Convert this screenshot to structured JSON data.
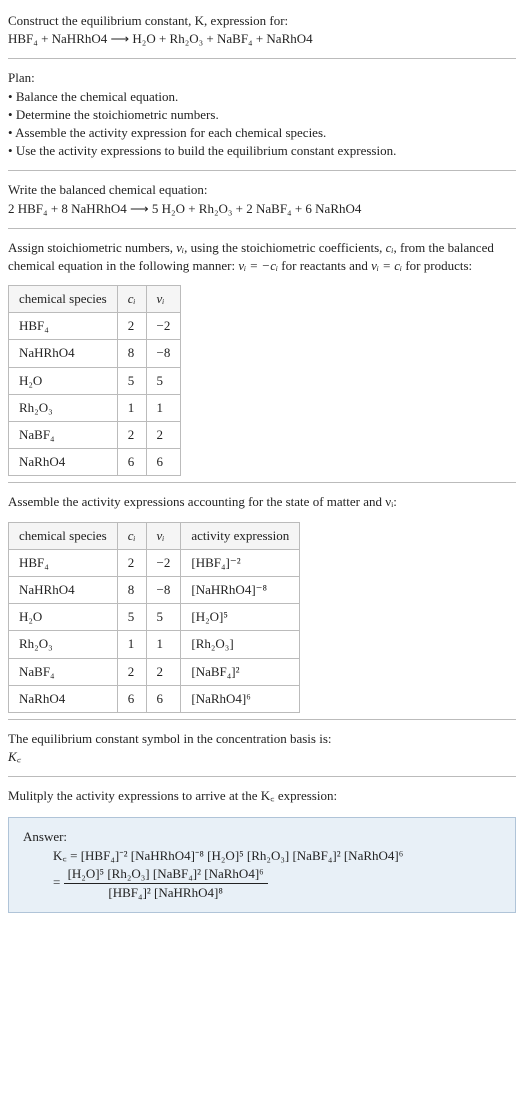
{
  "header": {
    "title_line": "Construct the equilibrium constant, K, expression for:",
    "equation": "HBF₄ + NaHRhO4 ⟶ H₂O + Rh₂O₃ + NaBF₄ + NaRhO4"
  },
  "plan": {
    "heading": "Plan:",
    "items": [
      "Balance the chemical equation.",
      "Determine the stoichiometric numbers.",
      "Assemble the activity expression for each chemical species.",
      "Use the activity expressions to build the equilibrium constant expression."
    ]
  },
  "balanced": {
    "heading": "Write the balanced chemical equation:",
    "equation": "2 HBF₄ + 8 NaHRhO4 ⟶ 5 H₂O + Rh₂O₃ + 2 NaBF₄ + 6 NaRhO4"
  },
  "assign": {
    "text_a": "Assign stoichiometric numbers, ",
    "nu": "νᵢ",
    "text_b": ", using the stoichiometric coefficients, ",
    "ci": "cᵢ",
    "text_c": ", from the balanced chemical equation in the following manner: ",
    "rel1": "νᵢ = −cᵢ",
    "text_d": " for reactants and ",
    "rel2": "νᵢ = cᵢ",
    "text_e": " for products:"
  },
  "table1": {
    "headers": [
      "chemical species",
      "cᵢ",
      "νᵢ"
    ],
    "rows": [
      [
        "HBF₄",
        "2",
        "−2"
      ],
      [
        "NaHRhO4",
        "8",
        "−8"
      ],
      [
        "H₂O",
        "5",
        "5"
      ],
      [
        "Rh₂O₃",
        "1",
        "1"
      ],
      [
        "NaBF₄",
        "2",
        "2"
      ],
      [
        "NaRhO4",
        "6",
        "6"
      ]
    ]
  },
  "assemble": {
    "text": "Assemble the activity expressions accounting for the state of matter and νᵢ:"
  },
  "table2": {
    "headers": [
      "chemical species",
      "cᵢ",
      "νᵢ",
      "activity expression"
    ],
    "rows": [
      {
        "sp": "HBF₄",
        "c": "2",
        "nu": "−2",
        "expr": "[HBF₄]⁻²"
      },
      {
        "sp": "NaHRhO4",
        "c": "8",
        "nu": "−8",
        "expr": "[NaHRhO4]⁻⁸"
      },
      {
        "sp": "H₂O",
        "c": "5",
        "nu": "5",
        "expr": "[H₂O]⁵"
      },
      {
        "sp": "Rh₂O₃",
        "c": "1",
        "nu": "1",
        "expr": "[Rh₂O₃]"
      },
      {
        "sp": "NaBF₄",
        "c": "2",
        "nu": "2",
        "expr": "[NaBF₄]²"
      },
      {
        "sp": "NaRhO4",
        "c": "6",
        "nu": "6",
        "expr": "[NaRhO4]⁶"
      }
    ]
  },
  "symbol": {
    "line1": "The equilibrium constant symbol in the concentration basis is:",
    "sym": "K꜀"
  },
  "multiply": {
    "text": "Mulitply the activity expressions to arrive at the K꜀ expression:"
  },
  "answer": {
    "label": "Answer:",
    "flat": "K꜀ = [HBF₄]⁻² [NaHRhO4]⁻⁸ [H₂O]⁵ [Rh₂O₃] [NaBF₄]² [NaRhO4]⁶",
    "frac_num": "[H₂O]⁵ [Rh₂O₃] [NaBF₄]² [NaRhO4]⁶",
    "frac_den": "[HBF₄]² [NaHRhO4]⁸"
  },
  "chart_data": {
    "type": "table",
    "title": "Stoichiometric coefficients and numbers",
    "columns": [
      "chemical species",
      "c_i",
      "nu_i"
    ],
    "rows": [
      {
        "chemical species": "HBF4",
        "c_i": 2,
        "nu_i": -2
      },
      {
        "chemical species": "NaHRhO4",
        "c_i": 8,
        "nu_i": -8
      },
      {
        "chemical species": "H2O",
        "c_i": 5,
        "nu_i": 5
      },
      {
        "chemical species": "Rh2O3",
        "c_i": 1,
        "nu_i": 1
      },
      {
        "chemical species": "NaBF4",
        "c_i": 2,
        "nu_i": 2
      },
      {
        "chemical species": "NaRhO4",
        "c_i": 6,
        "nu_i": 6
      }
    ]
  }
}
